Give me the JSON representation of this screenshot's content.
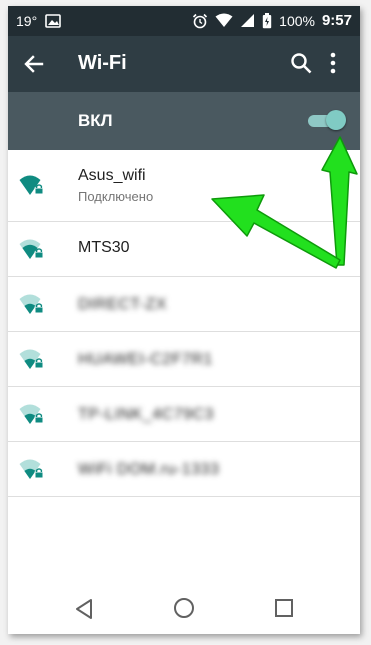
{
  "status_bar": {
    "temperature": "19°",
    "battery_percent": "100%",
    "time": "9:57",
    "icons": [
      "image-icon",
      "alarm-icon",
      "wifi-signal-icon",
      "cell-signal-icon",
      "battery-icon"
    ]
  },
  "app_bar": {
    "title": "Wi-Fi",
    "icons": [
      "back-arrow-icon",
      "search-icon",
      "more-vert-icon"
    ]
  },
  "switch_bar": {
    "label": "ВКЛ",
    "enabled": true
  },
  "networks": [
    {
      "name": "Asus_wifi",
      "status": "Подключено",
      "secured": true,
      "signal_level": 4
    },
    {
      "name": "MTS30",
      "status": "",
      "secured": true,
      "signal_level": 3
    },
    {
      "name": "DIRECT-ZX",
      "status": "",
      "secured": true,
      "signal_level": 2,
      "blurred": true
    },
    {
      "name": "HUAWEI-C2F7R1",
      "status": "",
      "secured": true,
      "signal_level": 2,
      "blurred": true
    },
    {
      "name": "TP-LINK_4C79C3",
      "status": "",
      "secured": true,
      "signal_level": 2,
      "blurred": true
    },
    {
      "name": "WiFi DOM.ru-1333",
      "status": "",
      "secured": true,
      "signal_level": 2,
      "blurred": true
    }
  ],
  "nav_bar": {
    "icons": [
      "nav-back-icon",
      "nav-home-icon",
      "nav-recents-icon"
    ]
  },
  "colors": {
    "status_bar": "#222d33",
    "app_bar": "#2f3d44",
    "switch_bar": "#4a5960",
    "accent_teal": "#0f8b81",
    "toggle_thumb": "#80cbc4",
    "arrow_green": "#22e01e"
  }
}
